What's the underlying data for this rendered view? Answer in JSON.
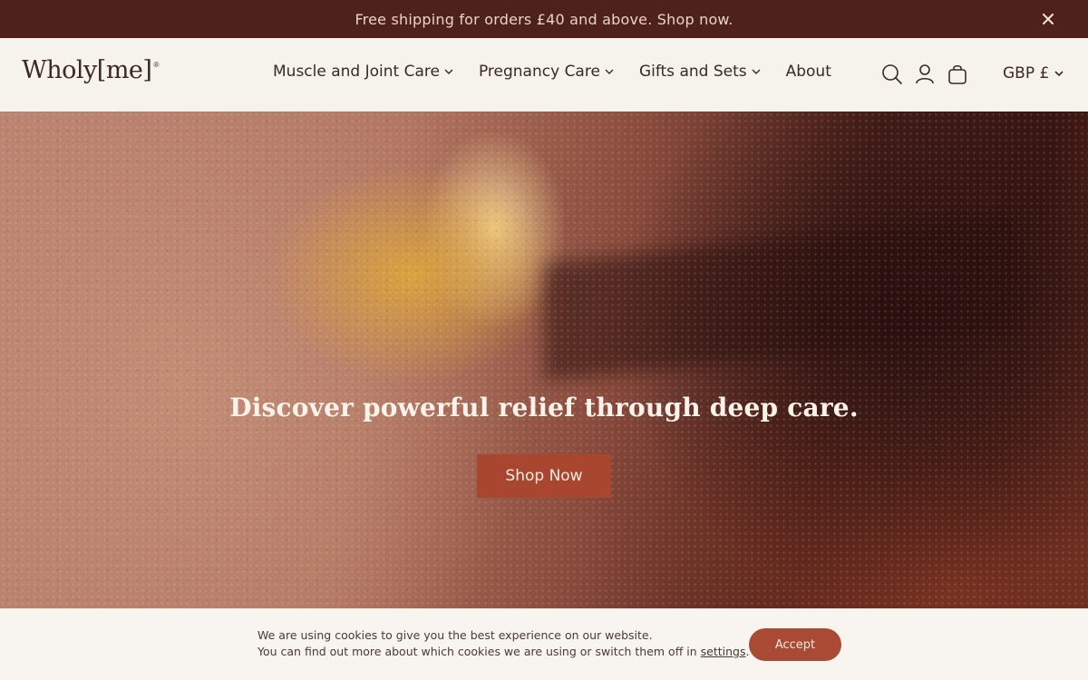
{
  "announcement": {
    "text": "Free shipping for orders £40 and above. Shop now.",
    "close_icon": "close-icon"
  },
  "header": {
    "logo": "Wholy[me]",
    "logo_mark": "®",
    "nav": [
      {
        "label": "Muscle and Joint Care",
        "has_dropdown": true
      },
      {
        "label": "Pregnancy Care",
        "has_dropdown": true
      },
      {
        "label": "Gifts and Sets",
        "has_dropdown": true
      },
      {
        "label": "About",
        "has_dropdown": false
      }
    ],
    "icons": [
      "search-icon",
      "account-icon",
      "cart-icon"
    ],
    "currency": "GBP £"
  },
  "hero": {
    "title": "Discover powerful relief through deep care.",
    "button": "Shop Now"
  },
  "cookie": {
    "line1": "We are using cookies to give you the best experience on our website.",
    "line2_prefix": "You can find out more about which cookies we are using or switch them off in ",
    "link": "settings",
    "line2_suffix": ".",
    "accept": "Accept"
  },
  "colors": {
    "announcement_bg": "#4e211d",
    "header_bg": "#f6f2ec",
    "accent_button": "#a8462f",
    "text_dark": "#3a2a22"
  }
}
